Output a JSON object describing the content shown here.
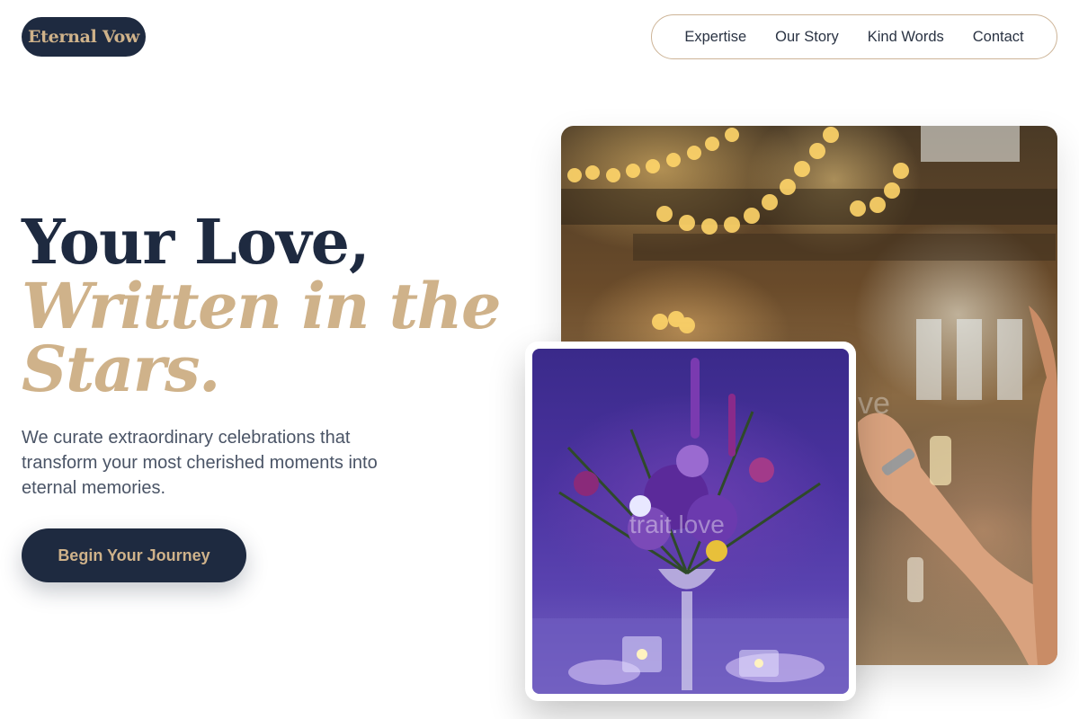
{
  "brand": {
    "logo_text": "Eternal Vow"
  },
  "nav": {
    "items": [
      {
        "label": "Expertise"
      },
      {
        "label": "Our Story"
      },
      {
        "label": "Kind Words"
      },
      {
        "label": "Contact"
      }
    ]
  },
  "hero": {
    "title_line1": "Your Love,",
    "title_line2": "Written in the",
    "title_line3": "Stars.",
    "description": "We curate extraordinary celebrations that transform your most cherished moments into eternal memories.",
    "cta_label": "Begin Your Journey"
  },
  "images": {
    "back_watermark": "ve",
    "front_watermark": "trait.love"
  },
  "colors": {
    "navy": "#1e2a40",
    "gold": "#cfb28a",
    "text_muted": "#4a5466"
  }
}
